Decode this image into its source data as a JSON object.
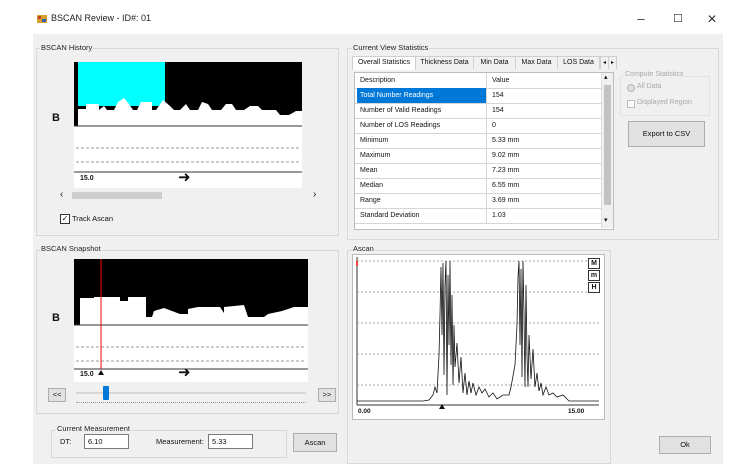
{
  "window": {
    "title": "BSCAN Review - ID#: 01",
    "minimize": "–",
    "maximize": "☐",
    "close": "✕"
  },
  "history": {
    "group_label": "BSCAN History",
    "b_label": "B",
    "depth_label": "15.0",
    "arrow": "➜",
    "scroll_left": "‹",
    "scroll_right": "›",
    "track_ascan_label": "Track Ascan",
    "track_ascan_checked": true
  },
  "stats": {
    "group_label": "Current View Statistics",
    "tabs": [
      "Overall Statistics",
      "Thickness Data",
      "Min Data",
      "Max Data",
      "LOS Data"
    ],
    "tab_scroll_left": "◂",
    "tab_scroll_right": "▸",
    "columns": [
      "Description",
      "Value"
    ],
    "rows": [
      {
        "description": "Total Number Readings",
        "value": "154"
      },
      {
        "description": "Number of Valid Readings",
        "value": "154"
      },
      {
        "description": "Number of LOS Readings",
        "value": "0"
      },
      {
        "description": "Minimum",
        "value": "5.33 mm"
      },
      {
        "description": "Maximum",
        "value": "9.02 mm"
      },
      {
        "description": "Mean",
        "value": "7.23 mm"
      },
      {
        "description": "Median",
        "value": "6.55 mm"
      },
      {
        "description": "Range",
        "value": "3.69 mm"
      },
      {
        "description": "Standard Deviation",
        "value": "1.03"
      }
    ],
    "scroll_up": "▴",
    "scroll_down": "▾"
  },
  "compute": {
    "group_label": "Compute Statistics",
    "options": [
      "All Data",
      "Displayed Region"
    ],
    "selected": "All Data",
    "export_label": "Export to CSV"
  },
  "snapshot": {
    "group_label": "BSCAN Snapshot",
    "b_label": "B",
    "depth_label": "15.0",
    "arrow": "➜",
    "prev_label": "<<",
    "next_label": ">>",
    "slider_position": 0.13
  },
  "measurement": {
    "group_label": "Current Measurement",
    "dt_label": "DT:",
    "dt_value": "6.10",
    "measurement_label": "Measurement:",
    "measurement_value": "5.33",
    "ascan_button": "Ascan"
  },
  "ascan": {
    "group_label": "Ascan",
    "x_min_label": "0.00",
    "x_max_label": "15.00",
    "mode_buttons": [
      "M",
      "m",
      "H"
    ]
  },
  "ok_label": "Ok",
  "colors": {
    "highlight_cyan": "#00ffff",
    "selection_blue": "#0078d7",
    "cursor_red": "#ff0000"
  }
}
